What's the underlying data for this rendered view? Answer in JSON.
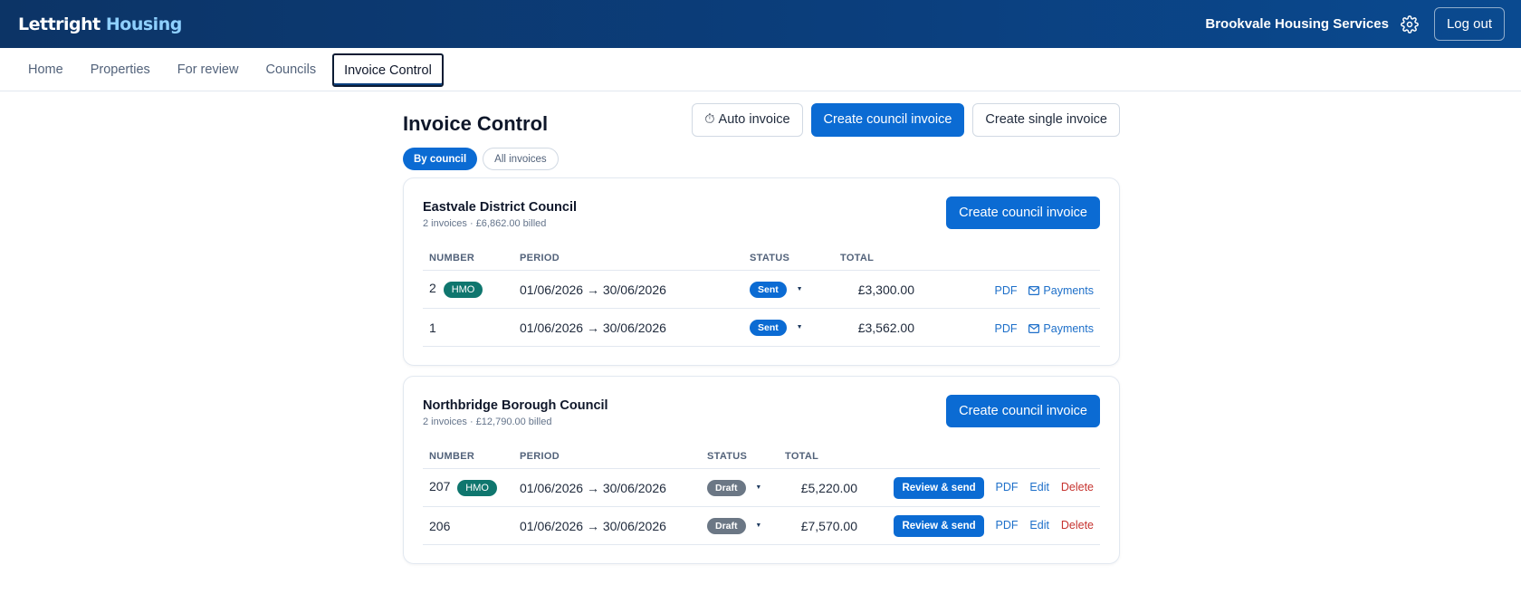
{
  "app": {
    "brand_main": "Lettright",
    "brand_accent": "Housing",
    "org_name": "Brookvale Housing Services",
    "logout_label": "Log out",
    "icons": {
      "settings": "gear-icon",
      "mail": "mail-icon",
      "timer": "stopwatch-icon",
      "dropdown": "chevron-down-icon"
    }
  },
  "nav": {
    "tabs": [
      {
        "label": "Home",
        "active": false
      },
      {
        "label": "Properties",
        "active": false
      },
      {
        "label": "For review",
        "active": false
      },
      {
        "label": "Councils",
        "active": false
      },
      {
        "label": "Invoice Control",
        "active": true
      }
    ]
  },
  "page": {
    "title": "Invoice Control",
    "auto_invoice_icon": "⏱",
    "auto_invoice_label": "Auto invoice",
    "create_council_label": "Create council invoice",
    "create_single_label": "Create single invoice",
    "filter_by_council": "By council",
    "filter_all": "All invoices"
  },
  "columns": {
    "number": "NUMBER",
    "period": "PERIOD",
    "status": "STATUS",
    "total": "TOTAL"
  },
  "councils": [
    {
      "name": "Eastvale District Council",
      "meta": "2 invoices · £6,862.00 billed",
      "create_label": "Create council invoice",
      "rows": [
        {
          "number": "2",
          "tag": "HMO",
          "period": "01/06/2026 → 30/06/2026",
          "status": "Sent",
          "total": "£3,300.00",
          "pdf": "PDF",
          "payments": "Payments"
        },
        {
          "number": "1",
          "tag": "",
          "period": "01/06/2026 → 30/06/2026",
          "status": "Sent",
          "total": "£3,562.00",
          "pdf": "PDF",
          "payments": "Payments"
        }
      ]
    },
    {
      "name": "Northbridge Borough Council",
      "meta": "2 invoices · £12,790.00 billed",
      "create_label": "Create council invoice",
      "rows": [
        {
          "number": "207",
          "tag": "HMO",
          "period": "01/06/2026 → 30/06/2026",
          "status": "Draft",
          "total": "£5,220.00",
          "review": "Review & send",
          "pdf": "PDF",
          "edit": "Edit",
          "delete": "Delete"
        },
        {
          "number": "206",
          "tag": "",
          "period": "01/06/2026 → 30/06/2026",
          "status": "Draft",
          "total": "£7,570.00",
          "review": "Review & send",
          "pdf": "PDF",
          "edit": "Edit",
          "delete": "Delete"
        }
      ]
    }
  ],
  "colors": {
    "header": "#0b3f7e",
    "primary": "#0b6bd3",
    "hmo": "#0f766e",
    "draft": "#6b7785",
    "delete": "#c6332f",
    "link": "#1d6fc9"
  }
}
